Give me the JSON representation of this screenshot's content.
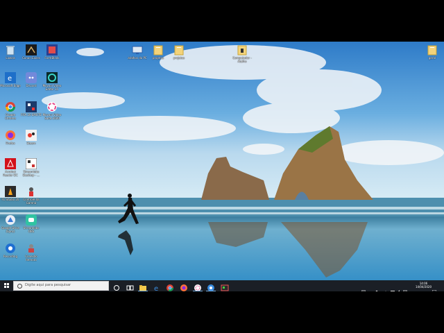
{
  "desktop": {
    "left_icons": [
      {
        "label": "Lixeira",
        "icon": "recycle-bin-icon"
      },
      {
        "label": "Conan Exiles",
        "icon": "conan-exiles-icon"
      },
      {
        "label": "FormBlank",
        "icon": "formblank-icon"
      },
      {
        "label": "Microsoft Edge",
        "icon": "edge-icon"
      },
      {
        "label": "Discord",
        "icon": "discord-icon"
      },
      {
        "label": "Movavi Video Editor 15",
        "icon": "movavi-icon"
      },
      {
        "label": "Google Chrome",
        "icon": "chrome-icon"
      },
      {
        "label": "FIFA 20 EMOTE",
        "icon": "fifa-icon"
      },
      {
        "label": "Movavi Video Suite 2020",
        "icon": "movavi-suite-icon"
      },
      {
        "label": "Firefox",
        "icon": "firefox-icon"
      },
      {
        "label": "Steam",
        "icon": "steam-icon"
      },
      {
        "label": "Acrobat Reader DC",
        "icon": "acrobat-icon"
      },
      {
        "label": "Streamlabs Desktop - ...",
        "icon": "streamlabs-icon"
      },
      {
        "label": "FL Studio 20",
        "icon": "fl-studio-icon"
      },
      {
        "label": "Controle da Garena",
        "icon": "garena-icon"
      },
      {
        "label": "Google Drive (Sync)",
        "icon": "google-drive-icon"
      },
      {
        "label": "Streamlabs OBS",
        "icon": "streamlabs-obs-icon"
      },
      {
        "label": "Recording",
        "icon": "recording-icon"
      },
      {
        "label": "Conexão Remota",
        "icon": "remote-connection-icon"
      }
    ],
    "top_icons": [
      {
        "label": "atalhos do PC",
        "icon": "pc-shortcut-icon"
      },
      {
        "label": "projetos",
        "icon": "folder-icon"
      },
      {
        "label": "projetos",
        "icon": "folder-icon"
      },
      {
        "label": "Computador - Atalho",
        "icon": "computer-shortcut-icon"
      },
      {
        "label": "geral",
        "icon": "folder-icon"
      }
    ]
  },
  "taskbar": {
    "search_placeholder": "Digite aqui para pesquisar",
    "time": "14:06",
    "date": "14/04/2020"
  }
}
